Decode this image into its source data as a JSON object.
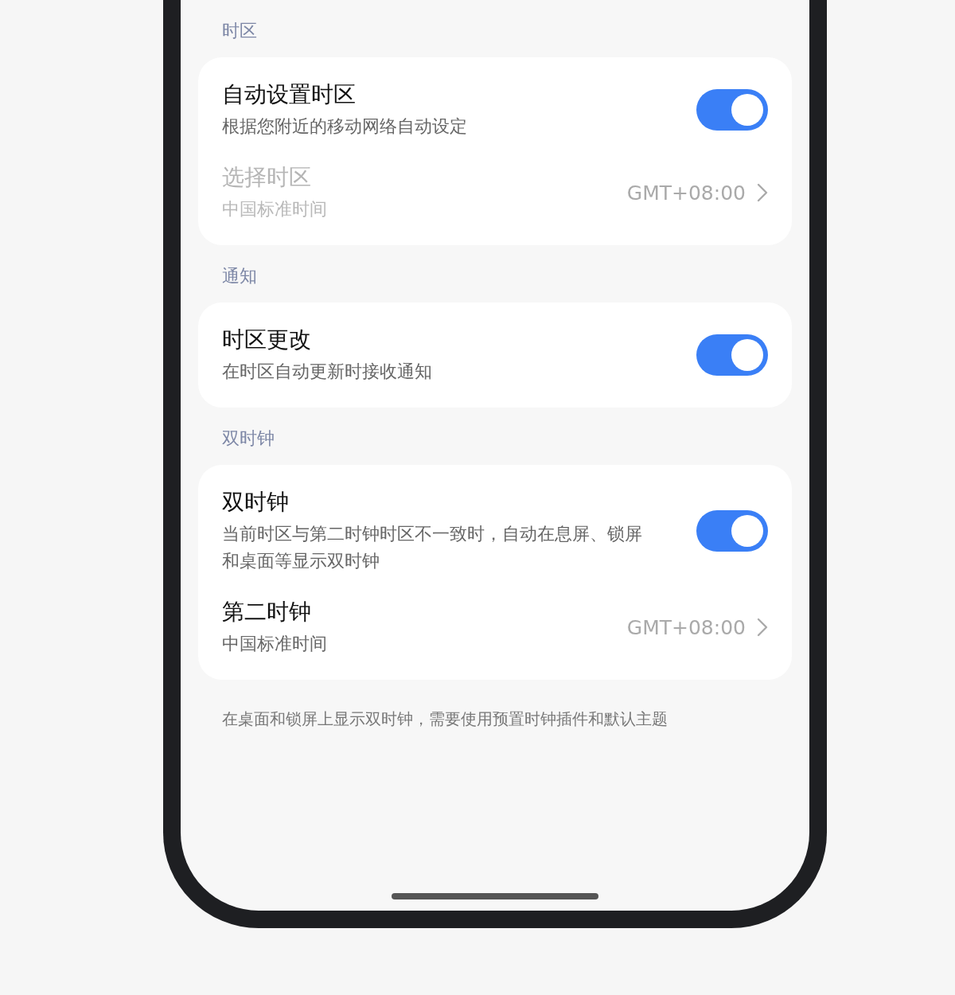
{
  "sections": [
    {
      "header": "时区",
      "items": [
        {
          "kind": "toggle",
          "title": "自动设置时区",
          "subtitle": "根据您附近的移动网络自动设定",
          "on": true
        },
        {
          "kind": "link",
          "title": "选择时区",
          "subtitle": "中国标准时间",
          "value": "GMT+08:00",
          "disabled": true
        }
      ]
    },
    {
      "header": "通知",
      "items": [
        {
          "kind": "toggle",
          "title": "时区更改",
          "subtitle": "在时区自动更新时接收通知",
          "on": true
        }
      ]
    },
    {
      "header": "双时钟",
      "items": [
        {
          "kind": "toggle",
          "title": "双时钟",
          "subtitle": "当前时区与第二时钟时区不一致时，自动在息屏、锁屏和桌面等显示双时钟",
          "on": true
        },
        {
          "kind": "link",
          "title": "第二时钟",
          "subtitle": "中国标准时间",
          "value": "GMT+08:00",
          "disabled": false
        }
      ]
    }
  ],
  "footnote": "在桌面和锁屏上显示双时钟，需要使用预置时钟插件和默认主题"
}
